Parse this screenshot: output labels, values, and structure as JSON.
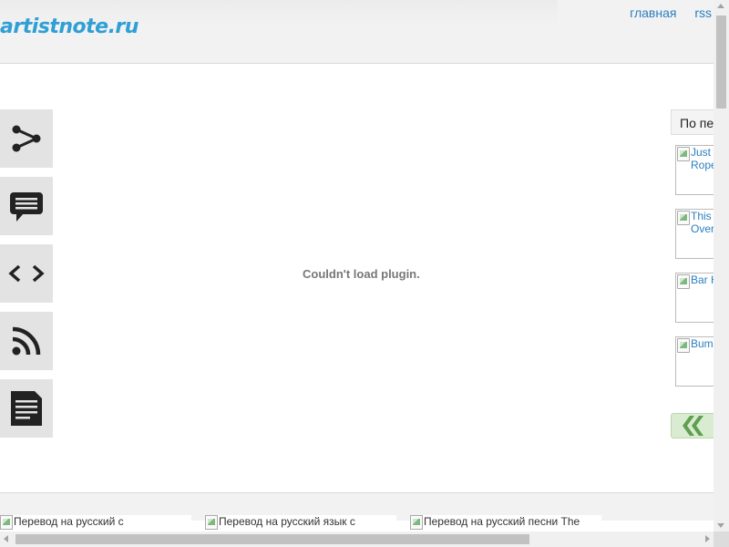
{
  "header": {
    "logo_text": "artistnote.ru",
    "nav": [
      {
        "label": "главная"
      },
      {
        "label": "rss"
      }
    ]
  },
  "share_bar": {
    "items": [
      {
        "icon": "share-icon"
      },
      {
        "icon": "comment-icon"
      },
      {
        "icon": "embed-code-icon"
      },
      {
        "icon": "rss-icon"
      },
      {
        "icon": "document-icon"
      }
    ]
  },
  "main": {
    "plugin_message": "Couldn't load plugin."
  },
  "right_sidebar": {
    "heading": "По пе",
    "thumbs": [
      {
        "line1": "Just",
        "line2": "Rope"
      },
      {
        "line1": "This",
        "line2": "Over"
      },
      {
        "line1": "Bar H",
        "line2": ""
      },
      {
        "line1": "Bum",
        "line2": ""
      }
    ],
    "nav_arrow_icon": "double-chevron-left-icon"
  },
  "related": [
    {
      "label": "Перевод на русский с"
    },
    {
      "label": "Перевод на русский язык с"
    },
    {
      "label": "Перевод на русский песни The"
    }
  ],
  "colors": {
    "logo": "#2f9fd5",
    "link": "#2a7fc0",
    "header_bg": "#f2f2f2",
    "share_btn_bg": "#e3e3e3"
  }
}
